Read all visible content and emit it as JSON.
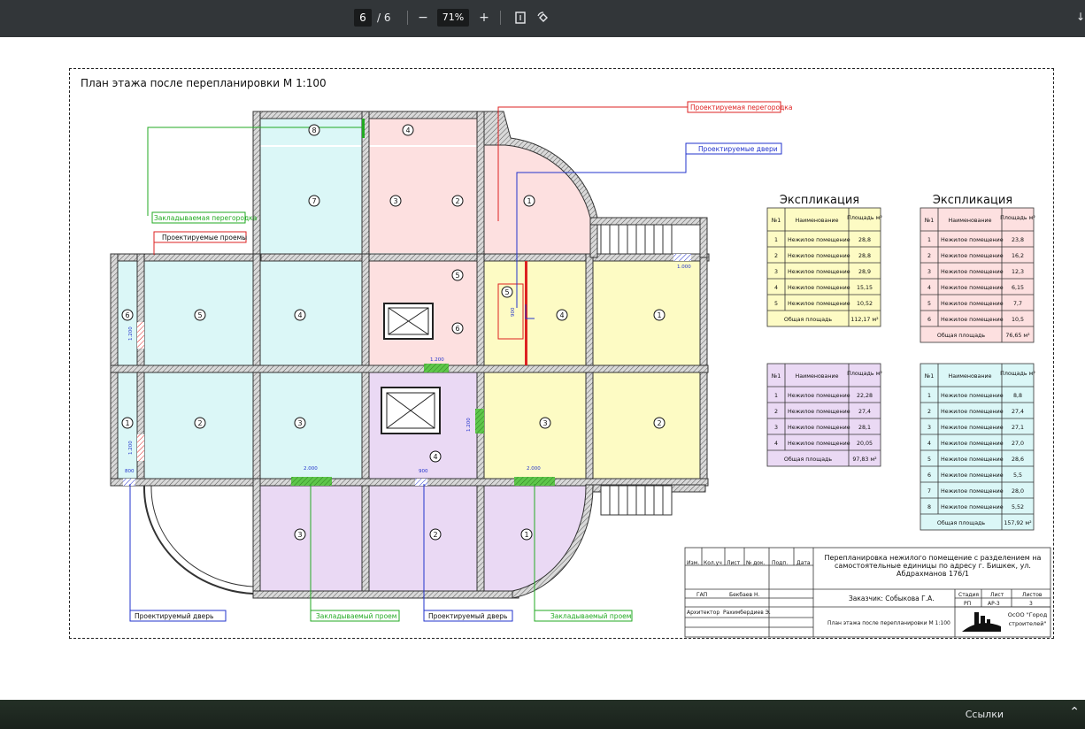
{
  "toolbar": {
    "page_current": "6",
    "page_separator": "/",
    "page_total": "6",
    "zoom_out_icon": "minus-icon",
    "zoom_value": "71%",
    "zoom_in_icon": "plus-icon",
    "fit_icon": "fit-page-icon",
    "rotate_icon": "rotate-icon",
    "download_icon": "download-icon"
  },
  "drawing": {
    "title": "План  этажа после перепланировки М 1:100",
    "callouts": {
      "partition": "Проектируемая перегородка",
      "doors": "Проектируемые двери",
      "bricked_partition": "Закладываемая перегородка",
      "openings": "Проектируемые проемы",
      "door_left": "Проектируемый дверь",
      "bricked_opening_1": "Закладываемый проем",
      "door_mid": "Проектируемый дверь",
      "bricked_opening_2": "Закладываемый проем"
    },
    "dimensions": {
      "d1": "1.200",
      "d2": "1.200",
      "d3": "1.200",
      "d4": "1.200",
      "d5": "2.000",
      "d6": "2.000",
      "d7": "800",
      "d8": "900",
      "d9": "900",
      "d10": "1.000"
    },
    "room_labels": {
      "r8": "8",
      "r4top": "4",
      "r7": "7",
      "r3a": "3",
      "r2a": "2",
      "r1a": "1",
      "r6left": "6",
      "r5left": "5",
      "r4left": "4",
      "r5mid": "5",
      "r6mid": "6",
      "r5small": "5",
      "r4y": "4",
      "r1y": "1",
      "r1left": "1",
      "r2left": "2",
      "r3left": "3",
      "r4p": "4",
      "r3y": "3",
      "r2y": "2",
      "r3p": "3",
      "r2p": "2",
      "r1p": "1"
    }
  },
  "explication": {
    "title_left": "Экспликация",
    "title_right": "Экспликация",
    "col_no": "№1",
    "col_name": "Наименование",
    "col_area": "Площадь м²",
    "total_label": "Общая площадь",
    "yellow": {
      "rows": [
        [
          "1",
          "Нежилое помещение",
          "28,8"
        ],
        [
          "2",
          "Нежилое помещение",
          "28,8"
        ],
        [
          "3",
          "Нежилое помещение",
          "28,9"
        ],
        [
          "4",
          "Нежилое помещение",
          "15,15"
        ],
        [
          "5",
          "Нежилое помещение",
          "10,52"
        ]
      ],
      "total": "112,17 м²"
    },
    "pink": {
      "rows": [
        [
          "1",
          "Нежилое помещение",
          "23,8"
        ],
        [
          "2",
          "Нежилое помещение",
          "16,2"
        ],
        [
          "3",
          "Нежилое помещение",
          "12,3"
        ],
        [
          "4",
          "Нежилое помещение",
          "6,15"
        ],
        [
          "5",
          "Нежилое помещение",
          "7,7"
        ],
        [
          "6",
          "Нежилое помещение",
          "10,5"
        ]
      ],
      "total": "76,65 м²"
    },
    "purple": {
      "rows": [
        [
          "1",
          "Нежилое помещение",
          "22,28"
        ],
        [
          "2",
          "Нежилое помещение",
          "27,4"
        ],
        [
          "3",
          "Нежилое помещение",
          "28,1"
        ],
        [
          "4",
          "Нежилое помещение",
          "20,05"
        ]
      ],
      "total": "97,83 м²"
    },
    "cyan": {
      "rows": [
        [
          "1",
          "Нежилое помещение",
          "8,8"
        ],
        [
          "2",
          "Нежилое помещение",
          "27,4"
        ],
        [
          "3",
          "Нежилое помещение",
          "27,1"
        ],
        [
          "4",
          "Нежилое помещение",
          "27,0"
        ],
        [
          "5",
          "Нежилое помещение",
          "28,6"
        ],
        [
          "6",
          "Нежилое помещение",
          "5,5"
        ],
        [
          "7",
          "Нежилое помещение",
          "28,0"
        ],
        [
          "8",
          "Нежилое помещение",
          "5,52"
        ]
      ],
      "total": "157,92 м²"
    },
    "colors": {
      "yellow": "#fdfbc4",
      "pink": "#fde0e0",
      "purple": "#ead9f4",
      "cyan": "#dbf7f7"
    }
  },
  "stamp": {
    "h_izm": "Изм.",
    "h_koluch": "Кол.уч",
    "h_list": "Лист",
    "h_ndok": "№ док.",
    "h_podp": "Подп.",
    "h_data": "Дата",
    "project_title": "Перепланировка нежилого помещение с разделением на самостоятельные единицы по адресу г. Бишкек, ул. Абдрахманов 176/1",
    "gap_label": "ГАП",
    "gap_name": "Бекбаев Н.",
    "arch_label": "Архитектор",
    "arch_name": "Рахимбердиев Э.",
    "customer": "Заказчик: Собыкова Г.А.",
    "stage_h": "Стадия",
    "sheet_h": "Лист",
    "sheets_h": "Листов",
    "stage": "РП",
    "sheet": "АР-3",
    "sheets": "3",
    "sheet_name": "План  этажа после перепланировки М 1:100",
    "company": "ОсОО \"Город строителей\""
  },
  "bottombar": {
    "links_label": "Ссылки",
    "chevron_icon": "chevron-up-icon"
  }
}
